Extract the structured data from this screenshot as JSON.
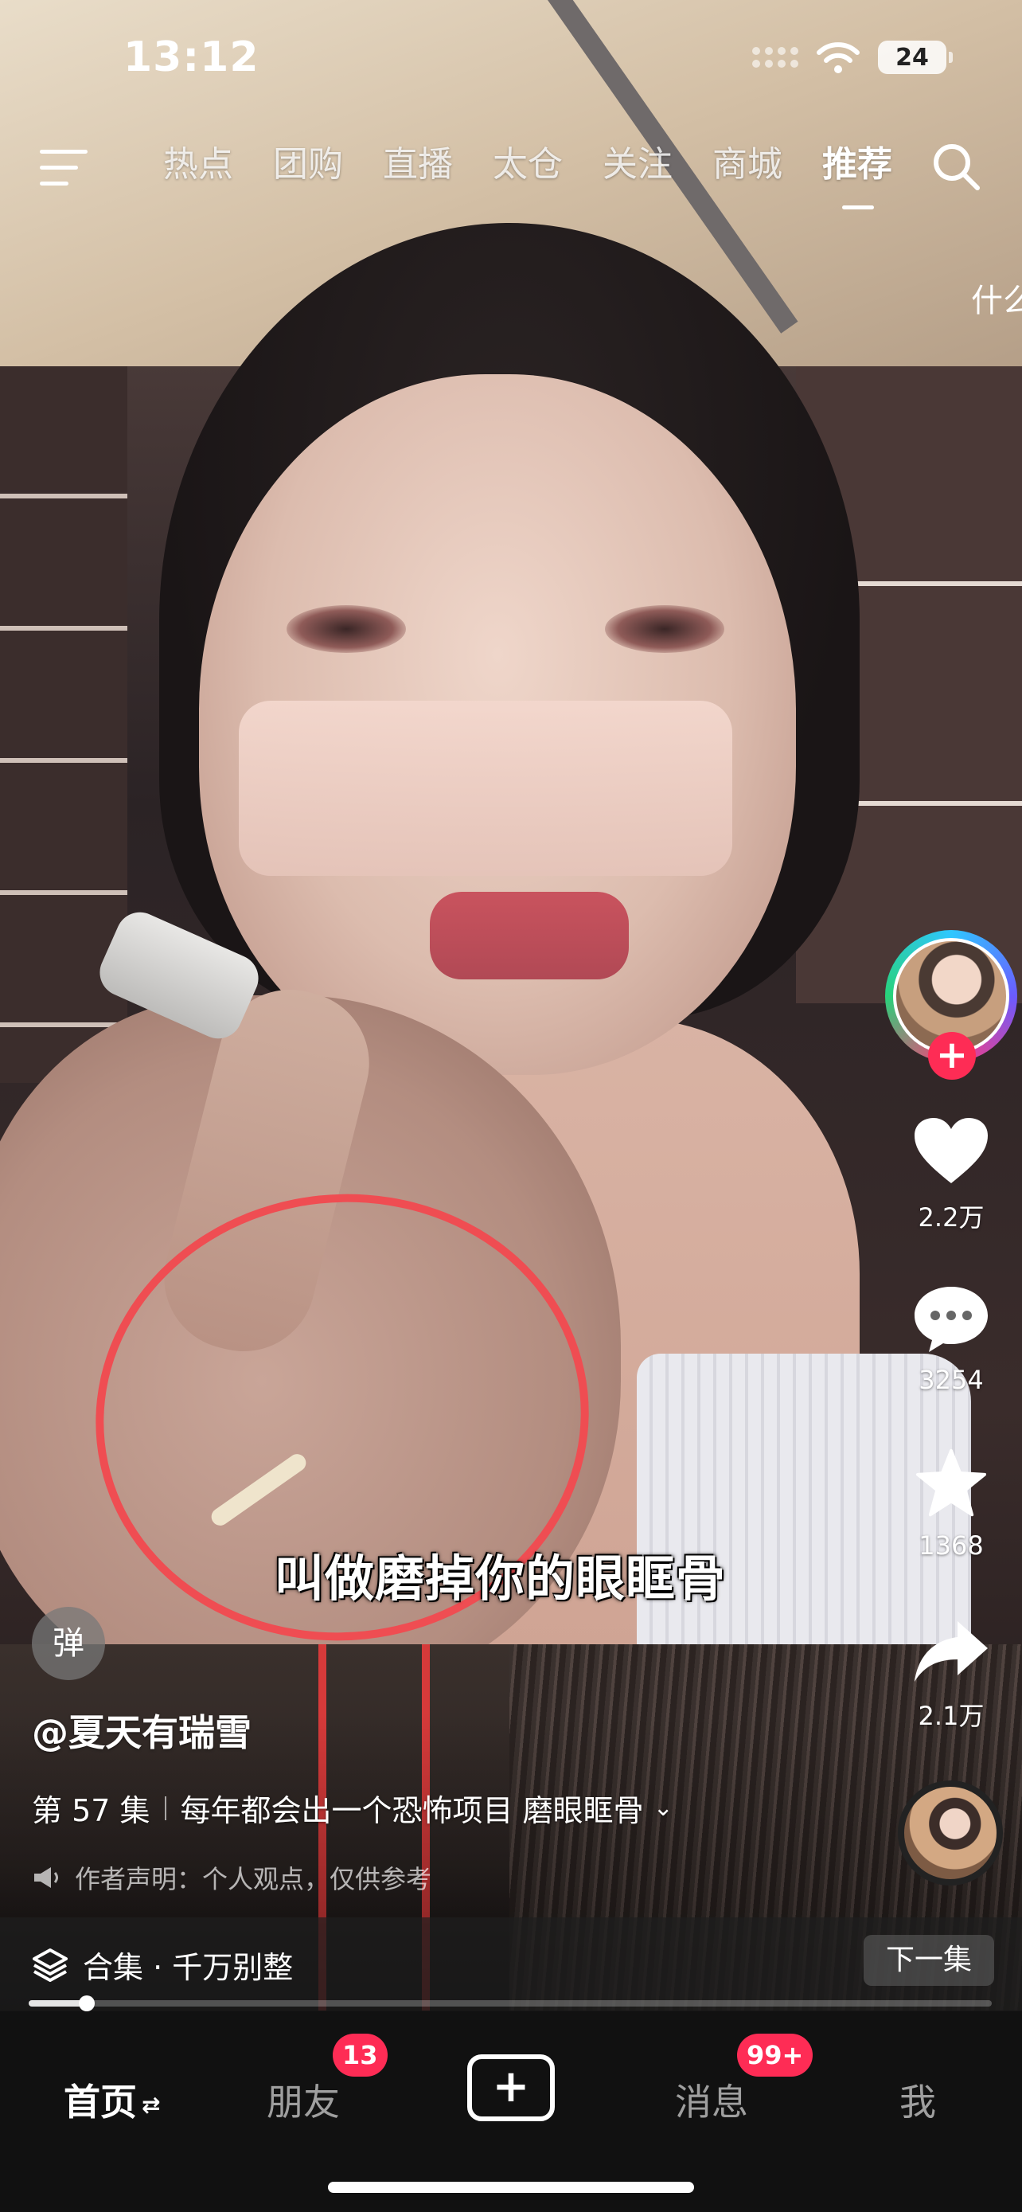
{
  "status_bar": {
    "time": "13:12",
    "battery": "24"
  },
  "top_nav": {
    "tabs": [
      "热点",
      "团购",
      "直播",
      "太仓",
      "关注",
      "商城",
      "推荐"
    ],
    "active_tab": "推荐",
    "peek_text": "什么"
  },
  "video": {
    "subtitle": "叫做磨掉你的眼眶骨",
    "danmaku_label": "弹"
  },
  "actions": {
    "likes": "2.2万",
    "comments": "3254",
    "favorites": "1368",
    "shares": "2.1万",
    "follow_label": "+"
  },
  "caption": {
    "author": "@夏天有瑞雪",
    "episode": "第 57 集",
    "title": "每年都会出一个恐怖项目 磨眼眶骨",
    "chevron": "⌄",
    "disclaimer": "作者声明：个人观点，仅供参考"
  },
  "collection": {
    "label": "合集 · 千万别整",
    "next_button": "下一集",
    "progress": 0.06
  },
  "bottom_tabs": {
    "home": "首页",
    "home_refresh": "⇄",
    "friends": "朋友",
    "friends_badge": "13",
    "publish": "+",
    "messages": "消息",
    "messages_badge": "99+",
    "me": "我"
  },
  "colors": {
    "accent": "#fe2c55",
    "circle_annotation": "#ef4d52"
  }
}
